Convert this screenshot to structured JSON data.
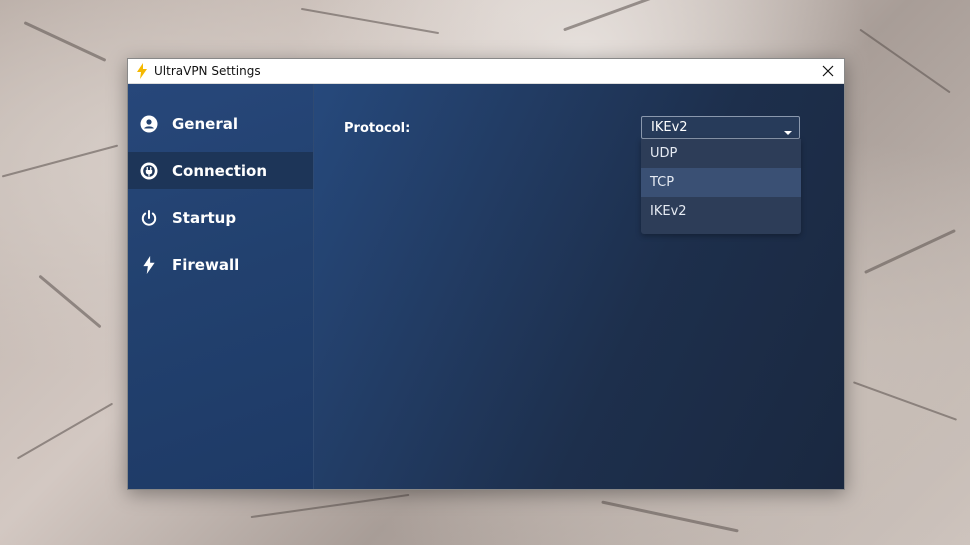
{
  "window": {
    "title": "UltraVPN Settings",
    "close_label": "✕"
  },
  "sidebar": {
    "items": [
      {
        "label": "General",
        "icon": "user-circle-icon",
        "active": false
      },
      {
        "label": "Connection",
        "icon": "plug-circle-icon",
        "active": true
      },
      {
        "label": "Startup",
        "icon": "power-icon",
        "active": false
      },
      {
        "label": "Firewall",
        "icon": "bolt-icon",
        "active": false
      }
    ]
  },
  "main": {
    "protocol_label": "Protocol:",
    "protocol_select": {
      "selected": "IKEv2",
      "options": [
        "UDP",
        "TCP",
        "IKEv2"
      ],
      "highlighted": "TCP"
    }
  },
  "colors": {
    "sidebar_bg": "#22416f",
    "active_item_bg": "#1d3558",
    "main_bg": "#1d2f4c",
    "dropdown_bg": "#2d3d58",
    "dropdown_highlight": "#3a5074",
    "bolt_accent": "#f5b800"
  }
}
